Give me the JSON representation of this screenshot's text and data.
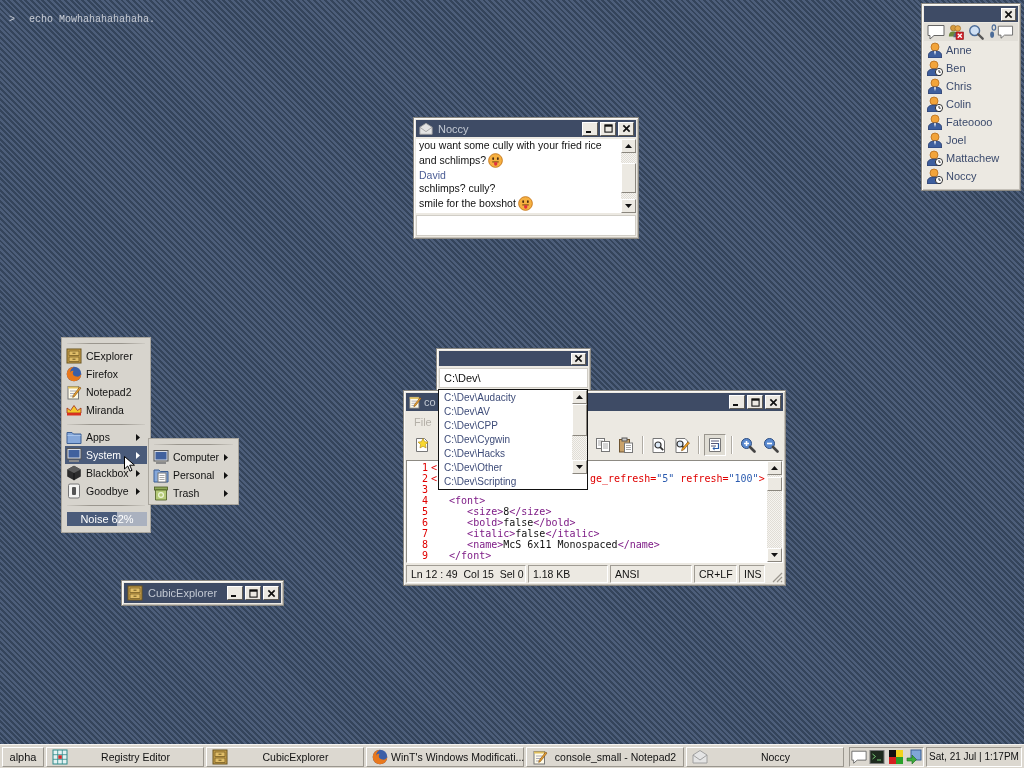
{
  "console": {
    "prompt": ">",
    "command": "echo Mowhahahahahaha."
  },
  "contact_list": {
    "contacts": [
      {
        "name": "Anne",
        "away": false,
        "selected": false
      },
      {
        "name": "Ben",
        "away": true,
        "selected": false
      },
      {
        "name": "Chris",
        "away": false,
        "selected": false
      },
      {
        "name": "Colin",
        "away": true,
        "selected": false
      },
      {
        "name": "Fateoooo",
        "away": false,
        "selected": false
      },
      {
        "name": "Joel",
        "away": false,
        "selected": false
      },
      {
        "name": "Mattachew",
        "away": true,
        "selected": false
      },
      {
        "name": "Noccy",
        "away": true,
        "selected": false
      }
    ]
  },
  "chat_window": {
    "title": "Noccy",
    "messages": [
      {
        "kind": "text",
        "text": "you want some cully with your fried rice",
        "emoticon": false
      },
      {
        "kind": "text",
        "text": "and schlimps?",
        "emoticon": true
      },
      {
        "kind": "sender",
        "text": "David"
      },
      {
        "kind": "text",
        "text": "schlimps? cully?",
        "emoticon": false
      },
      {
        "kind": "text",
        "text": "smile for the boxshot",
        "emoticon": true
      }
    ]
  },
  "launcher": {
    "sections": [
      {
        "items": [
          {
            "label": "CExplorer",
            "submenu": false,
            "selected": false
          },
          {
            "label": "Firefox",
            "submenu": false,
            "selected": false
          },
          {
            "label": "Notepad2",
            "submenu": false,
            "selected": false
          },
          {
            "label": "Miranda",
            "submenu": false,
            "selected": false
          }
        ]
      },
      {
        "items": [
          {
            "label": "Apps",
            "submenu": true,
            "selected": false
          },
          {
            "label": "System",
            "submenu": true,
            "selected": true
          },
          {
            "label": "Blackbox",
            "submenu": true,
            "selected": false
          },
          {
            "label": "Goodbye",
            "submenu": true,
            "selected": false
          }
        ]
      }
    ],
    "meter": {
      "label": "Noise 62%",
      "level": 0.62
    }
  },
  "submenu": {
    "items": [
      {
        "label": "Computer",
        "submenu": true,
        "selected": false
      },
      {
        "label": "Personal",
        "submenu": true,
        "selected": false
      },
      {
        "label": "Trash",
        "submenu": true,
        "selected": false
      }
    ]
  },
  "notepad": {
    "title": "co",
    "menu": [
      {
        "label": "File",
        "disabled": true
      }
    ],
    "toolbar": [
      {
        "kind": "new",
        "pressed": false
      },
      {
        "kind": "copy",
        "pressed": false
      },
      {
        "kind": "paste",
        "pressed": false
      },
      {
        "kind": "separator"
      },
      {
        "kind": "find",
        "pressed": false
      },
      {
        "kind": "replace",
        "pressed": false
      },
      {
        "kind": "separator"
      },
      {
        "kind": "word-wrap",
        "pressed": true
      },
      {
        "kind": "separator"
      },
      {
        "kind": "zoom-in",
        "pressed": false
      },
      {
        "kind": "zoom-out",
        "pressed": false
      }
    ],
    "lines": [
      {
        "number": "1",
        "tokens": [
          {
            "kind": "declaration",
            "text": "<"
          }
        ]
      },
      {
        "number": "2",
        "tokens": [
          {
            "kind": "declaration",
            "text": "<"
          }
        ],
        "tokens_after_popup": [
          {
            "kind": "declaration",
            "text": "ge_refresh="
          },
          {
            "kind": "string",
            "text": "\"5\""
          },
          {
            "kind": "declaration",
            "text": " refresh="
          },
          {
            "kind": "string",
            "text": "\"100\""
          },
          {
            "kind": "declaration",
            "text": ">"
          }
        ],
        "children": [
          {
            "number": "3"
          },
          {
            "number": "4",
            "tokens": [
              {
                "kind": "tag",
                "text": "<font>"
              }
            ],
            "children": [
              {
                "number": "5",
                "tokens": [
                  {
                    "kind": "tag",
                    "text": "<size>"
                  },
                  {
                    "kind": "plain",
                    "text": "8"
                  },
                  {
                    "kind": "tag",
                    "text": "</size>"
                  }
                ]
              },
              {
                "number": "6",
                "tokens": [
                  {
                    "kind": "tag",
                    "text": "<bold>"
                  },
                  {
                    "kind": "plain",
                    "text": "false"
                  },
                  {
                    "kind": "tag",
                    "text": "</bold>"
                  }
                ]
              },
              {
                "number": "7",
                "tokens": [
                  {
                    "kind": "tag",
                    "text": "<italic>"
                  },
                  {
                    "kind": "plain",
                    "text": "false"
                  },
                  {
                    "kind": "tag",
                    "text": "</italic>"
                  }
                ]
              },
              {
                "number": "8",
                "tokens": [
                  {
                    "kind": "tag",
                    "text": "<name>"
                  },
                  {
                    "kind": "plain",
                    "text": "McS 6x11 Monospaced"
                  },
                  {
                    "kind": "tag",
                    "text": "</name>"
                  }
                ]
              }
            ]
          },
          {
            "number": "9",
            "tokens": [
              {
                "kind": "tag",
                "text": "</font>"
              }
            ]
          }
        ]
      }
    ],
    "status_bar": [
      "Ln 12 : 49  Col 15  Sel 0",
      "1.18 KB",
      "ANSI",
      "CR+LF",
      "INS"
    ]
  },
  "run_dialog": {
    "value": "C:\\Dev\\",
    "suggestions": [
      {
        "text": "C:\\Dev\\Audacity",
        "selected": false
      },
      {
        "text": "C:\\Dev\\AV",
        "selected": false
      },
      {
        "text": "C:\\Dev\\CPP",
        "selected": false
      },
      {
        "text": "C:\\Dev\\Cygwin",
        "selected": false
      },
      {
        "text": "C:\\Dev\\Hacks",
        "selected": false
      },
      {
        "text": "C:\\Dev\\Other",
        "selected": false
      },
      {
        "text": "C:\\Dev\\Scripting",
        "selected": false
      }
    ]
  },
  "minimized_window": {
    "title": "CubicExplorer"
  },
  "taskbar": {
    "workspace": "alpha",
    "tasks": [
      {
        "label": "Registry Editor",
        "selected": false
      },
      {
        "label": "CubicExplorer",
        "selected": false
      },
      {
        "label": "WinT's Windows Modificati...",
        "selected": false
      },
      {
        "label": "console_small - Notepad2",
        "selected": false
      },
      {
        "label": "Noccy",
        "selected": false
      }
    ],
    "clock": "Sat, 21 Jul | 1:17PM"
  }
}
